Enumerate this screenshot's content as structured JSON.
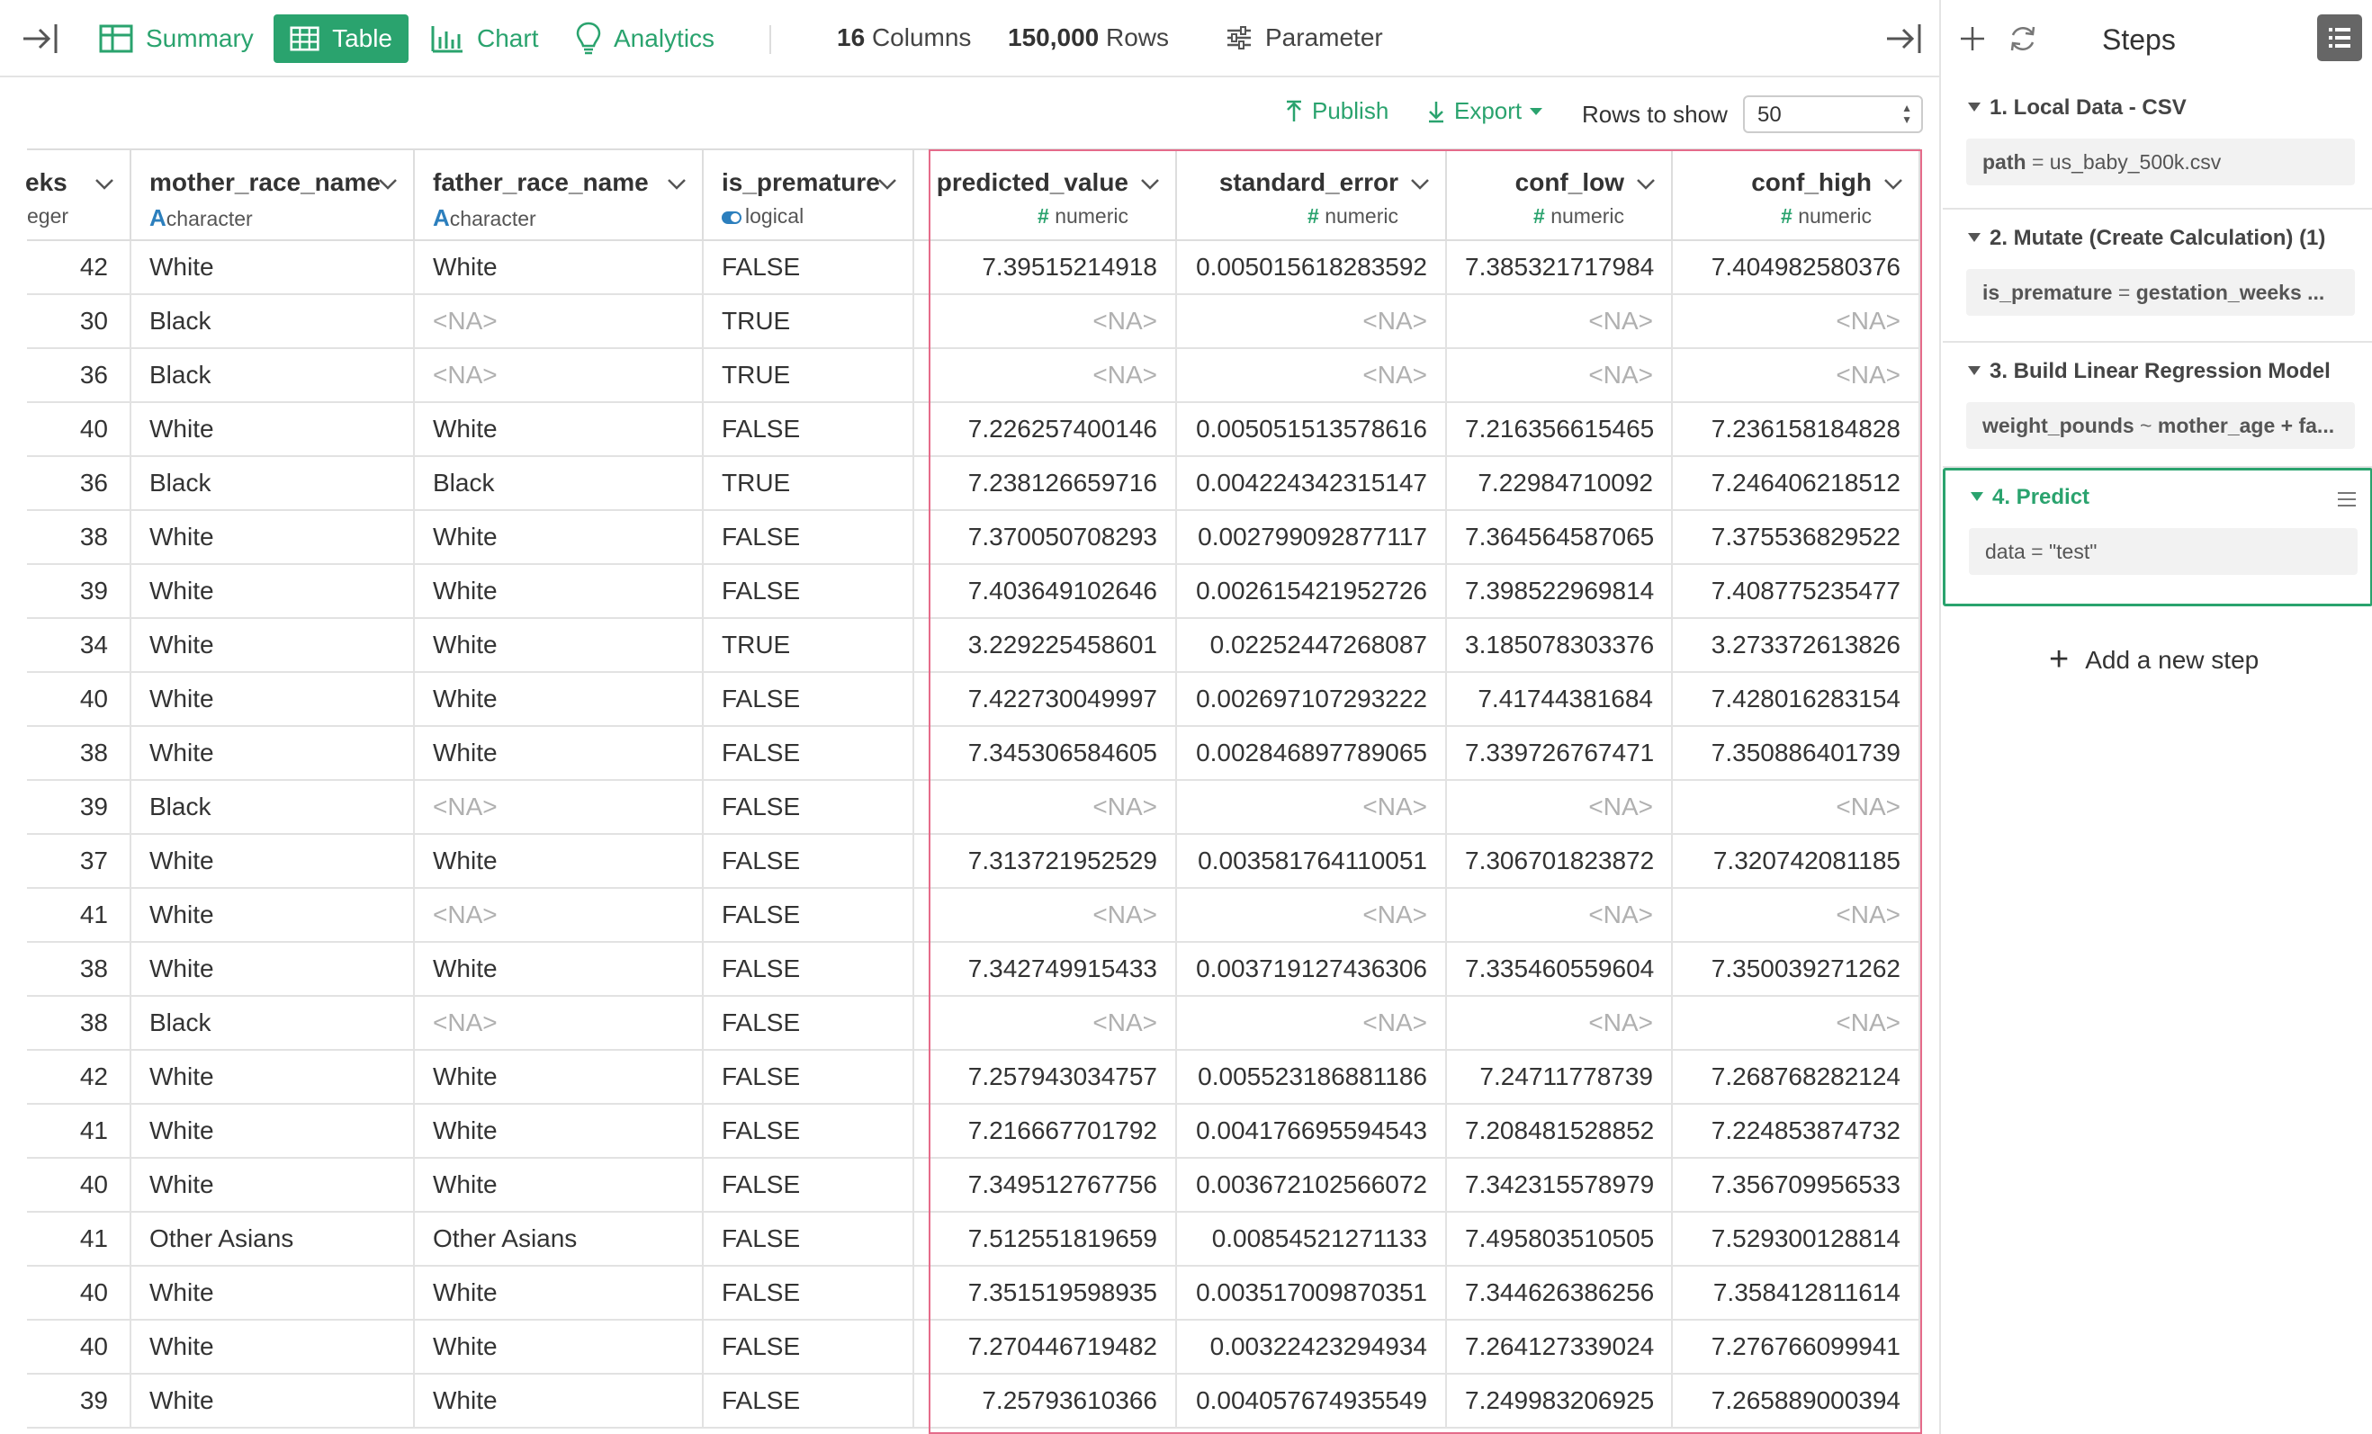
{
  "toolbar": {
    "tabs": [
      {
        "label": "Summary",
        "icon": "summary-table-icon"
      },
      {
        "label": "Table",
        "icon": "table-icon",
        "active": true
      },
      {
        "label": "Chart",
        "icon": "bar-chart-icon"
      },
      {
        "label": "Analytics",
        "icon": "lightbulb-icon"
      }
    ],
    "columns_count": "16",
    "columns_label": "Columns",
    "rows_count": "150,000",
    "rows_label": "Rows",
    "parameter_label": "Parameter"
  },
  "actions": {
    "publish_label": "Publish",
    "export_label": "Export",
    "rows_to_show_label": "Rows to show",
    "rows_to_show_value": "50"
  },
  "table": {
    "columns": [
      {
        "name": "eks",
        "type": "eger",
        "type_icon": ""
      },
      {
        "name": "mother_race_name",
        "type": "character",
        "type_icon": "A"
      },
      {
        "name": "father_race_name",
        "type": "character",
        "type_icon": "A"
      },
      {
        "name": "is_premature",
        "type": "logical",
        "type_icon": "toggle"
      },
      {
        "name": "predicted_value",
        "type": "numeric",
        "type_icon": "#"
      },
      {
        "name": "standard_error",
        "type": "numeric",
        "type_icon": "#"
      },
      {
        "name": "conf_low",
        "type": "numeric",
        "type_icon": "#"
      },
      {
        "name": "conf_high",
        "type": "numeric",
        "type_icon": "#"
      }
    ],
    "rows": [
      [
        "42",
        "White",
        "White",
        "FALSE",
        "7.39515214918",
        "0.005015618283592",
        "7.385321717984",
        "7.404982580376"
      ],
      [
        "30",
        "Black",
        "<NA>",
        "TRUE",
        "<NA>",
        "<NA>",
        "<NA>",
        "<NA>"
      ],
      [
        "36",
        "Black",
        "<NA>",
        "TRUE",
        "<NA>",
        "<NA>",
        "<NA>",
        "<NA>"
      ],
      [
        "40",
        "White",
        "White",
        "FALSE",
        "7.226257400146",
        "0.005051513578616",
        "7.216356615465",
        "7.236158184828"
      ],
      [
        "36",
        "Black",
        "Black",
        "TRUE",
        "7.238126659716",
        "0.004224342315147",
        "7.22984710092",
        "7.246406218512"
      ],
      [
        "38",
        "White",
        "White",
        "FALSE",
        "7.370050708293",
        "0.002799092877117",
        "7.364564587065",
        "7.375536829522"
      ],
      [
        "39",
        "White",
        "White",
        "FALSE",
        "7.403649102646",
        "0.002615421952726",
        "7.398522969814",
        "7.408775235477"
      ],
      [
        "34",
        "White",
        "White",
        "TRUE",
        "3.229225458601",
        "0.02252447268087",
        "3.185078303376",
        "3.273372613826"
      ],
      [
        "40",
        "White",
        "White",
        "FALSE",
        "7.422730049997",
        "0.002697107293222",
        "7.41744381684",
        "7.428016283154"
      ],
      [
        "38",
        "White",
        "White",
        "FALSE",
        "7.345306584605",
        "0.002846897789065",
        "7.339726767471",
        "7.350886401739"
      ],
      [
        "39",
        "Black",
        "<NA>",
        "FALSE",
        "<NA>",
        "<NA>",
        "<NA>",
        "<NA>"
      ],
      [
        "37",
        "White",
        "White",
        "FALSE",
        "7.313721952529",
        "0.003581764110051",
        "7.306701823872",
        "7.320742081185"
      ],
      [
        "41",
        "White",
        "<NA>",
        "FALSE",
        "<NA>",
        "<NA>",
        "<NA>",
        "<NA>"
      ],
      [
        "38",
        "White",
        "White",
        "FALSE",
        "7.342749915433",
        "0.003719127436306",
        "7.335460559604",
        "7.350039271262"
      ],
      [
        "38",
        "Black",
        "<NA>",
        "FALSE",
        "<NA>",
        "<NA>",
        "<NA>",
        "<NA>"
      ],
      [
        "42",
        "White",
        "White",
        "FALSE",
        "7.257943034757",
        "0.005523186881186",
        "7.24711778739",
        "7.268768282124"
      ],
      [
        "41",
        "White",
        "White",
        "FALSE",
        "7.216667701792",
        "0.004176695594543",
        "7.208481528852",
        "7.224853874732"
      ],
      [
        "40",
        "White",
        "White",
        "FALSE",
        "7.349512767756",
        "0.003672102566072",
        "7.342315578979",
        "7.356709956533"
      ],
      [
        "41",
        "Other Asians",
        "Other Asians",
        "FALSE",
        "7.512551819659",
        "0.00854521271133",
        "7.495803510505",
        "7.529300128814"
      ],
      [
        "40",
        "White",
        "White",
        "FALSE",
        "7.351519598935",
        "0.003517009870351",
        "7.344626386256",
        "7.358412811614"
      ],
      [
        "40",
        "White",
        "White",
        "FALSE",
        "7.270446719482",
        "0.00322423294934",
        "7.264127339024",
        "7.276766099941"
      ],
      [
        "39",
        "White",
        "White",
        "FALSE",
        "7.25793610366",
        "0.004057674935549",
        "7.249983206925",
        "7.265889000394"
      ]
    ]
  },
  "steps": {
    "title": "Steps",
    "items": [
      {
        "title": "1. Local Data - CSV",
        "key": "path",
        "op": " = ",
        "value": "us_baby_500k.csv"
      },
      {
        "title": "2. Mutate (Create Calculation) (1)",
        "key": "is_premature",
        "op": " = ",
        "value": "gestation_weeks ..."
      },
      {
        "title": "3. Build Linear Regression Model",
        "key": "weight_pounds",
        "op": " ~ ",
        "value": "mother_age + fa..."
      },
      {
        "title": "4. Predict",
        "key": "data",
        "op": " = ",
        "value": "\"test\"",
        "active": true
      }
    ],
    "add_label": "Add a new step"
  },
  "colors": {
    "accent": "#2aa36e",
    "highlight": "#e56b8a",
    "type_char": "#2c7fbd"
  }
}
